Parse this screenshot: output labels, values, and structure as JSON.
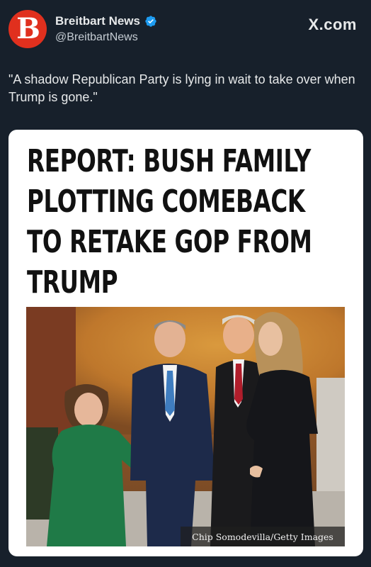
{
  "post": {
    "display_name": "Breitbart News",
    "handle": "@BreitbartNews",
    "avatar_letter": "B",
    "verified": true,
    "source": "X.com",
    "text": "\"A shadow Republican Party is lying in wait to take over when Trump is gone.\""
  },
  "card": {
    "headline_lines": [
      "REPORT: BUSH FAMILY",
      "PLOTTING COMEBACK",
      "TO RETAKE GOP FROM",
      "TRUMP"
    ],
    "photo_credit": "Chip Somodevilla/Getty Images"
  },
  "colors": {
    "background": "#17202b",
    "avatar_red": "#e0301e",
    "verified_blue": "#1d9bf0",
    "card": "#ffffff",
    "headline": "#111111"
  },
  "icons": {
    "verified": "verified-badge-icon"
  }
}
